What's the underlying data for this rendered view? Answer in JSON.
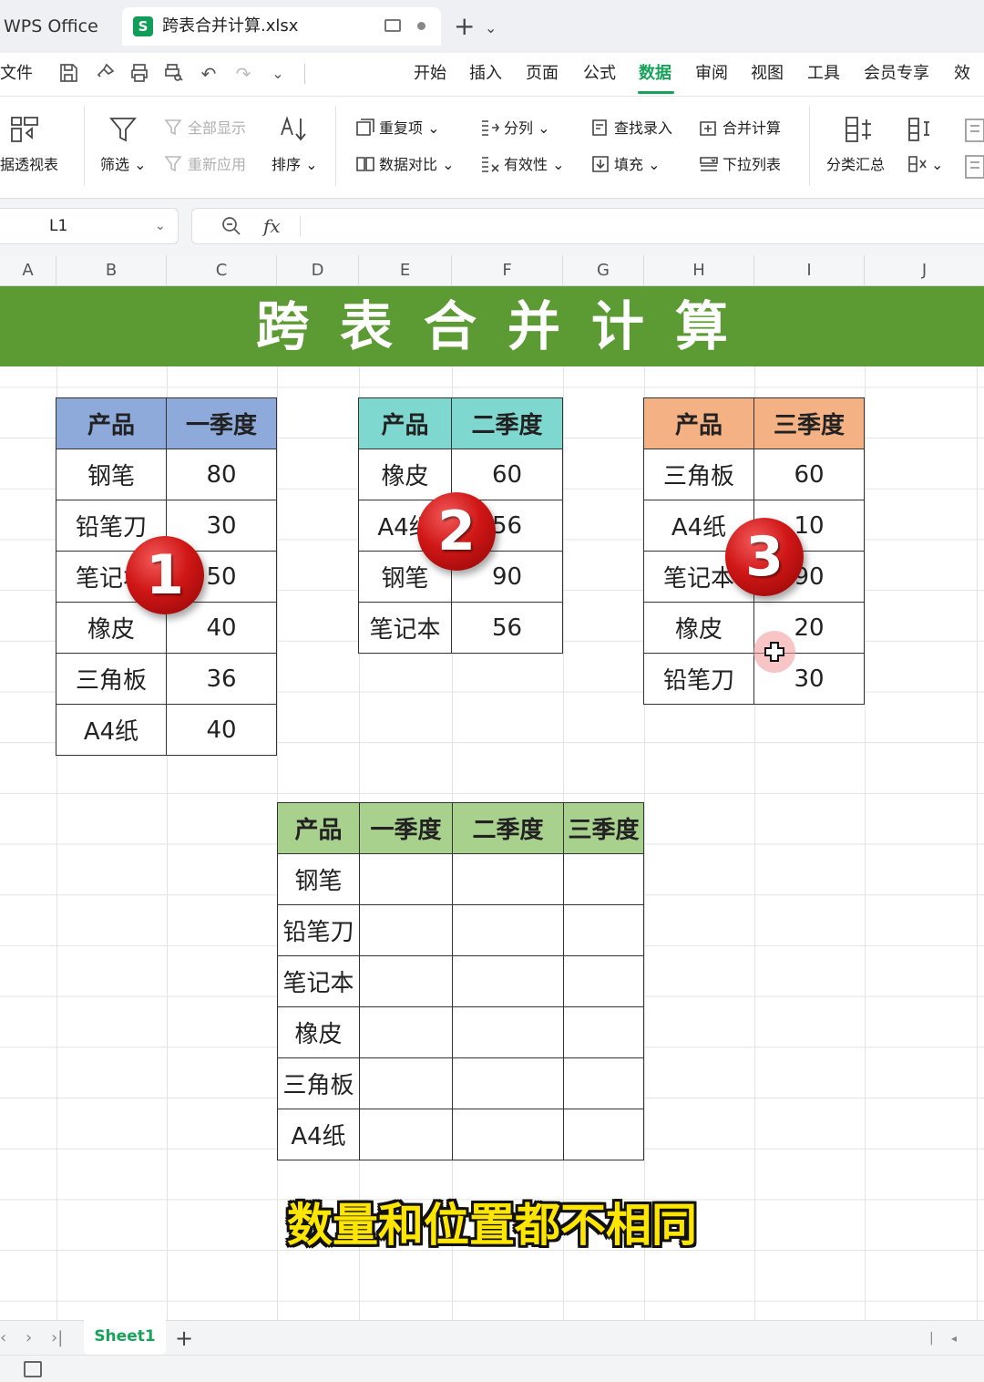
{
  "app": {
    "name": "WPS Office",
    "file_tab": "跨表合并计算.xlsx",
    "file_icon_letter": "S"
  },
  "menu": {
    "file": "文件",
    "items": [
      "开始",
      "插入",
      "页面",
      "公式",
      "数据",
      "审阅",
      "视图",
      "工具",
      "会员专享",
      "效率"
    ],
    "active": "数据"
  },
  "ribbon": {
    "pivot": "据透视表",
    "filter": "筛选",
    "show_all": "全部显示",
    "reapply": "重新应用",
    "sort": "排序",
    "duplicates": "重复项",
    "compare": "数据对比",
    "split": "分列",
    "validity": "有效性",
    "lookup_entry": "查找录入",
    "fill": "填充",
    "consolidate": "合并计算",
    "dropdown_list": "下拉列表",
    "subtotal": "分类汇总"
  },
  "formula_bar": {
    "name_box": "L1",
    "fx": "fx"
  },
  "columns": [
    "A",
    "B",
    "C",
    "D",
    "E",
    "F",
    "G",
    "H",
    "I",
    "J"
  ],
  "banner_title": "跨表合并计算",
  "table1": {
    "header": [
      "产品",
      "一季度"
    ],
    "rows": [
      [
        "钢笔",
        "80"
      ],
      [
        "铅笔刀",
        "30"
      ],
      [
        "笔记本",
        "50"
      ],
      [
        "橡皮",
        "40"
      ],
      [
        "三角板",
        "36"
      ],
      [
        "A4纸",
        "40"
      ]
    ]
  },
  "table2": {
    "header": [
      "产品",
      "二季度"
    ],
    "rows": [
      [
        "橡皮",
        "60"
      ],
      [
        "A4纸",
        "56"
      ],
      [
        "钢笔",
        "90"
      ],
      [
        "笔记本",
        "56"
      ]
    ]
  },
  "table3": {
    "header": [
      "产品",
      "三季度"
    ],
    "rows": [
      [
        "三角板",
        "60"
      ],
      [
        "A4纸",
        "10"
      ],
      [
        "笔记本",
        "90"
      ],
      [
        "橡皮",
        "20"
      ],
      [
        "铅笔刀",
        "30"
      ]
    ]
  },
  "summary": {
    "header": [
      "产品",
      "一季度",
      "二季度",
      "三季度"
    ],
    "products": [
      "钢笔",
      "铅笔刀",
      "笔记本",
      "橡皮",
      "三角板",
      "A4纸"
    ]
  },
  "badges": [
    "1",
    "2",
    "3"
  ],
  "subtitle": "数量和位置都不相同",
  "sheet_tab": "Sheet1",
  "colors": {
    "accent": "#18a35a",
    "banner": "#5c9a33",
    "t1": "#8eaadb",
    "t2": "#7fd8cf",
    "t3": "#f4b183",
    "t4": "#a9d18e"
  }
}
